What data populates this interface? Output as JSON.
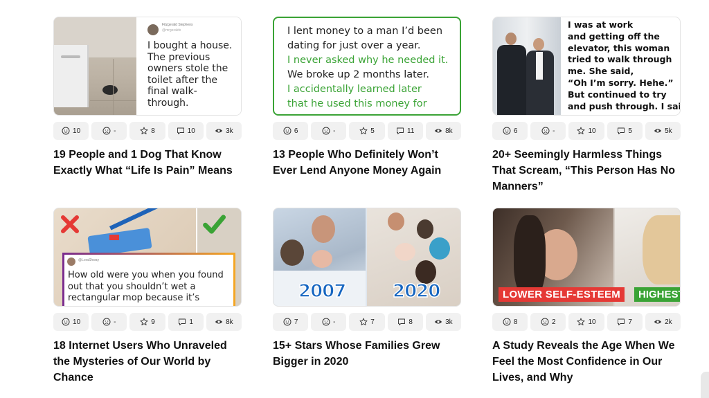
{
  "cards": [
    {
      "title": "19 People and 1 Dog That Know Exactly What “Life Is Pain” Means",
      "reactions": {
        "smile": "10",
        "frown": "-",
        "star": "8",
        "comments": "10",
        "views": "3k"
      },
      "image": {
        "tweet_user": "Fitzgerald Stephens",
        "tweet_handle": "@mrgeraldx",
        "text": "I bought a house. The previous owners stole the toilet after the final walk-through."
      }
    },
    {
      "title": "13 People Who Definitely Won’t Ever Lend Anyone Money Again",
      "reactions": {
        "smile": "6",
        "frown": "-",
        "star": "5",
        "comments": "11",
        "views": "8k"
      },
      "image": {
        "lines": [
          {
            "text": "I lent money to a man I’d been",
            "color": "#222222"
          },
          {
            "text": "dating for just over a year.",
            "color": "#222222"
          },
          {
            "text": "I never asked why he needed it.",
            "color": "#3aa335"
          },
          {
            "text": "We broke up 2 months later.",
            "color": "#222222"
          },
          {
            "text": "I accidentally learned later",
            "color": "#3aa335"
          },
          {
            "text": "that he used this money for",
            "color": "#3aa335"
          }
        ]
      }
    },
    {
      "title": "20+ Seemingly Harmless Things That Scream, “This Person Has No Manners”",
      "reactions": {
        "smile": "6",
        "frown": "-",
        "star": "10",
        "comments": "5",
        "views": "5k"
      },
      "image": {
        "lines": [
          "I was at work",
          "and getting off the",
          "elevator, this woman",
          "tried to walk through",
          "me. She said,",
          "“Oh I’m sorry. Hehe.”",
          "But continued to try",
          "and push through. I said,"
        ]
      }
    },
    {
      "title": "18 Internet Users Who Unraveled the Mysteries of Our World by Chance",
      "reactions": {
        "smile": "10",
        "frown": "-",
        "star": "9",
        "comments": "1",
        "views": "8k"
      },
      "image": {
        "tweet_user": "@LoraShway",
        "text": "How old were you when you found out that you shouldn’t wet a rectangular mop because it’s"
      }
    },
    {
      "title": "15+ Stars Whose Families Grew Bigger in 2020",
      "reactions": {
        "smile": "7",
        "frown": "-",
        "star": "7",
        "comments": "8",
        "views": "3k"
      },
      "image": {
        "year_left": "2007",
        "year_right": "2020"
      }
    },
    {
      "title": "A Study Reveals the Age When We Feel the Most Confidence in Our Lives, and Why",
      "reactions": {
        "smile": "8",
        "frown": "2",
        "star": "10",
        "comments": "7",
        "views": "2k"
      },
      "image": {
        "label_left": "LOWER SELF-ESTEEM",
        "label_right": "HIGHEST"
      }
    }
  ],
  "colors": {
    "green": "#3aa335",
    "red": "#e53935",
    "purple": "#7b2d8e",
    "orange": "#f5a623",
    "year_blue": "#1565c0"
  }
}
